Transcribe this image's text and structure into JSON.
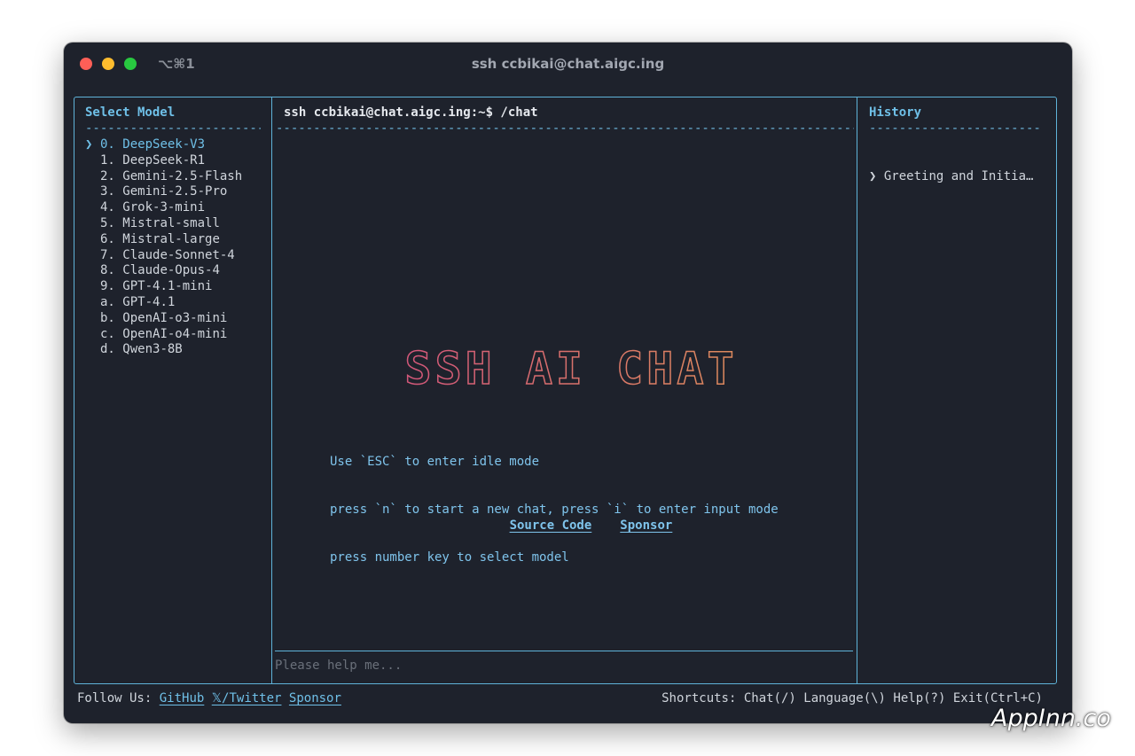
{
  "window": {
    "title": "ssh ccbikai@chat.aigc.ing",
    "tab_shortcut": "⌥⌘1"
  },
  "sidebar": {
    "title": "Select Model",
    "divider": "------------------------",
    "selected_marker": "❯",
    "items": [
      {
        "key": "0.",
        "label": "DeepSeek-V3"
      },
      {
        "key": "1.",
        "label": "DeepSeek-R1"
      },
      {
        "key": "2.",
        "label": "Gemini-2.5-Flash"
      },
      {
        "key": "3.",
        "label": "Gemini-2.5-Pro"
      },
      {
        "key": "4.",
        "label": "Grok-3-mini"
      },
      {
        "key": "5.",
        "label": "Mistral-small"
      },
      {
        "key": "6.",
        "label": "Mistral-large"
      },
      {
        "key": "7.",
        "label": "Claude-Sonnet-4"
      },
      {
        "key": "8.",
        "label": "Claude-Opus-4"
      },
      {
        "key": "9.",
        "label": "GPT-4.1-mini"
      },
      {
        "key": "a.",
        "label": "GPT-4.1"
      },
      {
        "key": "b.",
        "label": "OpenAI-o3-mini"
      },
      {
        "key": "c.",
        "label": "OpenAI-o4-mini"
      },
      {
        "key": "d.",
        "label": "Qwen3-8B"
      }
    ]
  },
  "main": {
    "prompt": "ssh ccbikai@chat.aigc.ing:~$ /chat",
    "divider": "--------------------------------------------------------------------------------",
    "logo_text": "SSH AI CHAT",
    "hints": [
      "Use `ESC` to enter idle mode",
      "press `n` to start a new chat, press `i` to enter input mode",
      "press number key to select model"
    ],
    "links": {
      "source_code": "Source Code",
      "sponsor": "Sponsor"
    },
    "input_placeholder": "Please help me..."
  },
  "history": {
    "title": "History",
    "divider": "------------------------",
    "items": [
      {
        "marker": "❯",
        "label": "Greeting and Initia…"
      }
    ]
  },
  "footer": {
    "follow_label": "Follow Us:",
    "github": "GitHub",
    "twitter": "𝕏/Twitter",
    "sponsor": "Sponsor",
    "shortcuts": "Shortcuts: Chat(/) Language(\\) Help(?) Exit(Ctrl+C)"
  },
  "watermark": "AppInn.co",
  "colors": {
    "background": "#1e222c",
    "border": "#5fb3d9",
    "accent": "#6fc0e8",
    "text": "#d0d5dc",
    "logo_gradient": [
      "#d3577a",
      "#dd8a5d"
    ]
  }
}
